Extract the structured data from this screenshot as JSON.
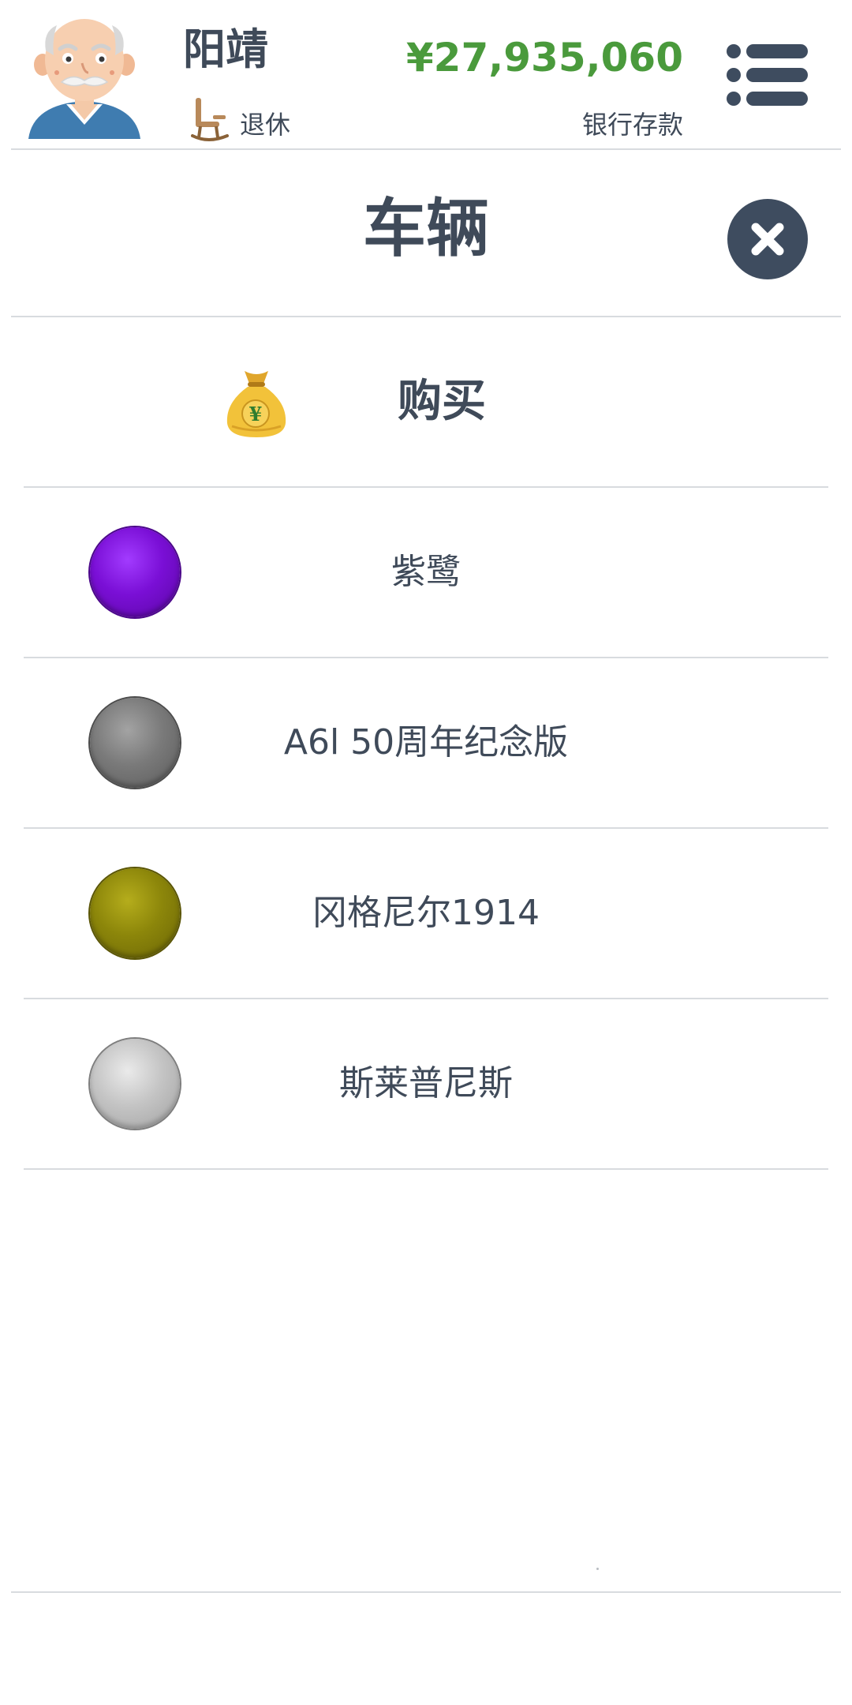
{
  "header": {
    "player_name": "阳靖",
    "status": "退休",
    "balance": "¥27,935,060",
    "balance_label": "银行存款",
    "balance_color": "#4a9a3c",
    "avatar_icon": "old-man-avatar-icon",
    "status_icon": "rocking-chair-icon",
    "menu_icon": "list-menu-icon"
  },
  "page": {
    "title": "车辆",
    "close_icon": "close-icon"
  },
  "buy": {
    "label": "购买",
    "icon": "money-bag-icon"
  },
  "vehicles": [
    {
      "name": "紫鹭",
      "color": "#7a0fd6"
    },
    {
      "name": "A6l 50周年纪念版",
      "color": "#7a7a7a"
    },
    {
      "name": "冈格尼尔1914",
      "color": "#8c860a"
    },
    {
      "name": "斯莱普尼斯",
      "color": "#c4c4c4"
    }
  ],
  "theme": {
    "text_color": "#3f4a59",
    "close_button_color": "#3e4c5f",
    "divider_color": "#d8dbdf"
  }
}
